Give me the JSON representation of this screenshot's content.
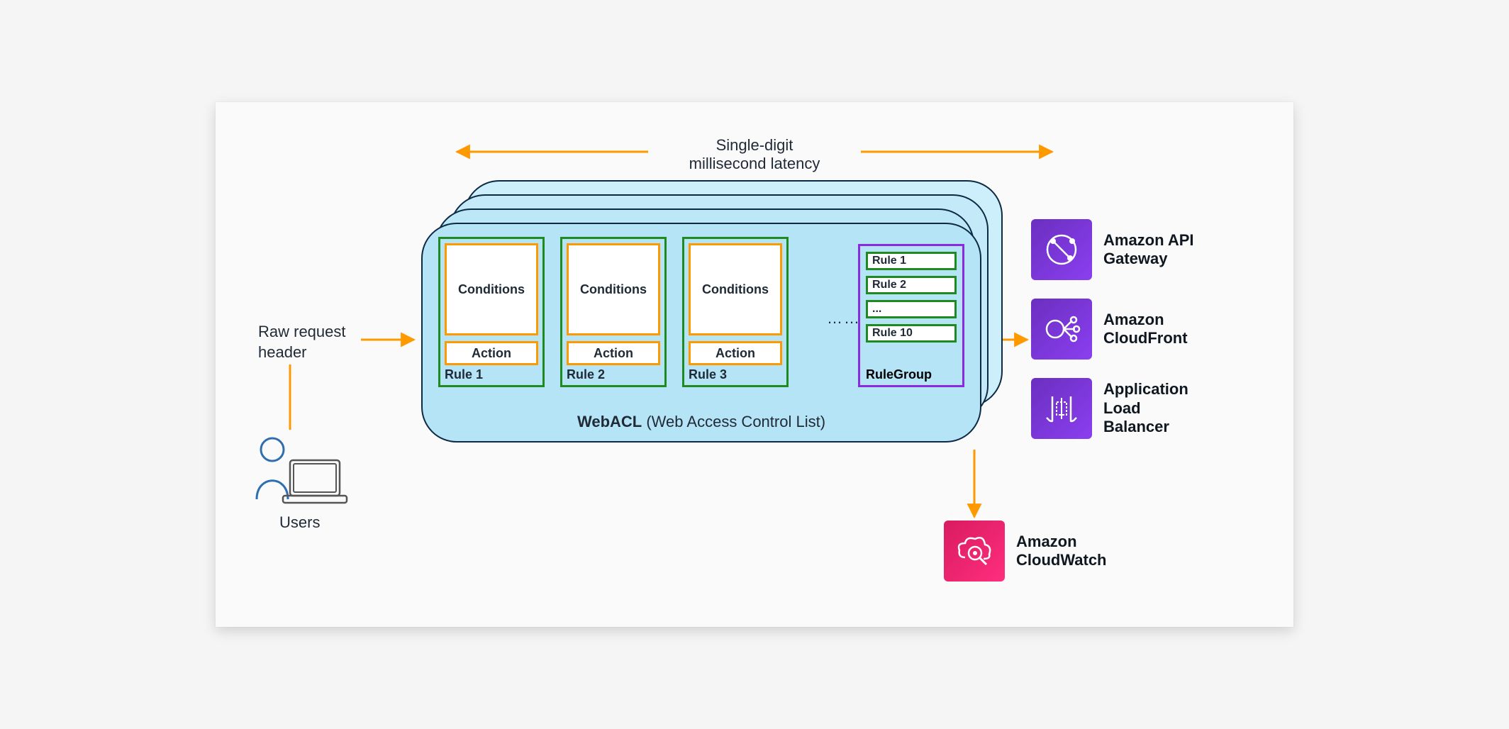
{
  "diagram": {
    "latency_label_line1": "Single-digit",
    "latency_label_line2": "millisecond latency",
    "raw_request_line1": "Raw request",
    "raw_request_line2": "header",
    "users_label": "Users",
    "ellipsis": "……",
    "webacl": {
      "title_bold": "WebACL",
      "title_rest": " (Web Access Control List)",
      "rules": [
        {
          "conditions": "Conditions",
          "action": "Action",
          "label": "Rule 1"
        },
        {
          "conditions": "Conditions",
          "action": "Action",
          "label": "Rule 2"
        },
        {
          "conditions": "Conditions",
          "action": "Action",
          "label": "Rule 3"
        }
      ],
      "rulegroup": {
        "label": "RuleGroup",
        "rules": [
          "Rule 1",
          "Rule 2",
          "...",
          "Rule 10"
        ]
      }
    },
    "services": [
      {
        "name": "Amazon API Gateway",
        "label_line1": "Amazon API",
        "label_line2": "Gateway"
      },
      {
        "name": "Amazon CloudFront",
        "label_line1": "Amazon",
        "label_line2": "CloudFront"
      },
      {
        "name": "Application Load Balancer",
        "label_line1": "Application",
        "label_line2": "Load",
        "label_line3": "Balancer"
      }
    ],
    "cloudwatch": {
      "label_line1": "Amazon",
      "label_line2": "CloudWatch"
    },
    "colors": {
      "arrow": "#ff9900",
      "dark": "#0d2a45",
      "webacl_fill": "#b5e4f6",
      "green": "#1f8a1f",
      "purple_outline": "#8a2be2",
      "service_purple_a": "#6b2fbf",
      "service_purple_b": "#8a3ff0",
      "cloudwatch_a": "#d81b60",
      "cloudwatch_b": "#ff2e7e"
    }
  }
}
